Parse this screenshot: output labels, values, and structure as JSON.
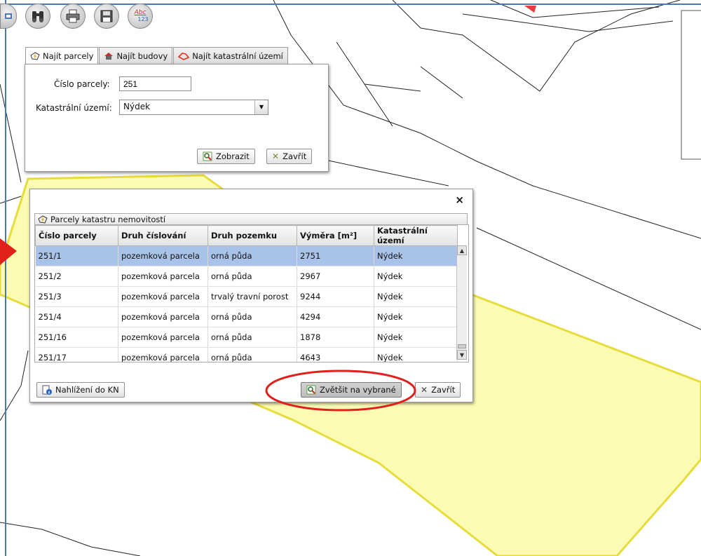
{
  "toolbar": {
    "buttons": [
      {
        "icon": "binoculars-icon"
      },
      {
        "icon": "printer-icon"
      },
      {
        "icon": "floppy-icon"
      },
      {
        "icon": "spellcheck-icon",
        "text_top": "Abc",
        "text_bottom": "123"
      }
    ]
  },
  "search_tabs": {
    "items": [
      {
        "label": "Najít parcely",
        "icon": "parcel-icon"
      },
      {
        "label": "Najít budovy",
        "icon": "house-icon"
      },
      {
        "label": "Najít katastrální území",
        "icon": "area-outline-icon"
      }
    ]
  },
  "search_form": {
    "parcel_label": "Číslo parcely:",
    "parcel_value": "251",
    "territory_label": "Katastrální území:",
    "territory_value": "Nýdek",
    "show_label": "Zobrazit",
    "close_label": "Zavřít"
  },
  "results": {
    "close_x": "×",
    "panel_title": "Parcely katastru nemovitostí",
    "columns": [
      "Číslo parcely",
      "Druh číslování",
      "Druh pozemku",
      "Výměra [m²]",
      "Katastrální území"
    ],
    "rows": [
      [
        "251/1",
        "pozemková parcela",
        "orná půda",
        "2751",
        "Nýdek"
      ],
      [
        "251/2",
        "pozemková parcela",
        "orná půda",
        "2967",
        "Nýdek"
      ],
      [
        "251/3",
        "pozemková parcela",
        "trvalý travní porost",
        "9244",
        "Nýdek"
      ],
      [
        "251/4",
        "pozemková parcela",
        "orná půda",
        "4294",
        "Nýdek"
      ],
      [
        "251/16",
        "pozemková parcela",
        "orná půda",
        "1878",
        "Nýdek"
      ],
      [
        "251/17",
        "pozemková parcela",
        "orná půda",
        "4643",
        "Nýdek"
      ]
    ],
    "selected_row": 0,
    "kn_label": "Nahlížení do KN",
    "zoom_label": "Zvětšit na vybrané",
    "close_label": "Zavřít"
  },
  "colors": {
    "parcel_fill": "#fbfbb4",
    "parcel_border": "#e6dc3c",
    "selection": "#a9c3e8",
    "annotation_red": "#e0201a"
  }
}
